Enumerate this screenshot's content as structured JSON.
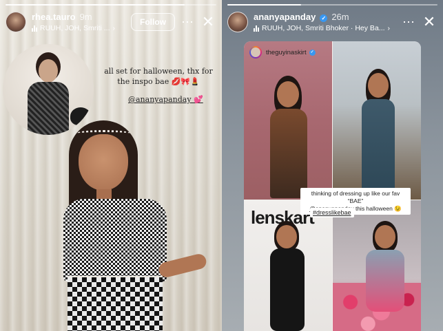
{
  "left_story": {
    "progress": 0.85,
    "username": "rhea.tauro",
    "time": "9m",
    "music": "RUUH, JOH, Smriti ...",
    "follow_label": "Follow",
    "more_icon": "more-horizontal-icon",
    "close_icon": "close-icon",
    "caption": "all set for halloween, thx for the inspo bae 💋🎀💄",
    "mention": "@ananyapanday 💕"
  },
  "right_story": {
    "progress": 0.35,
    "username": "ananyapanday",
    "time": "26m",
    "music": "RUUH, JOH, Smriti Bhoker · Hey Ba...",
    "more_icon": "more-horizontal-icon",
    "close_icon": "close-icon",
    "shared_post_user": "theguyinaskirt",
    "sticker_line1": "thinking of dressing up like our fav “BAE”",
    "sticker_mention": "@ananyapanday",
    "sticker_line2": " this halloween 😉",
    "hashtag": "#dresslikebae",
    "lens_text": "lenskart"
  },
  "colors": {
    "verified_badge": "#3897f0",
    "story_gradient": [
      "#f58529",
      "#dd2a7b",
      "#8134af",
      "#515bd4"
    ]
  }
}
